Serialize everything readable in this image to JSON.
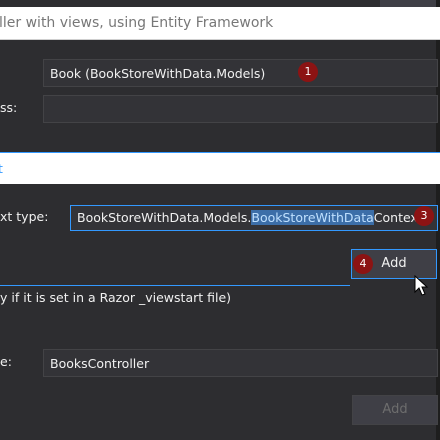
{
  "dialog": {
    "title": "ller with views, using Entity Framework"
  },
  "model": {
    "value": "Book (BookStoreWithData.Models)",
    "badge": "1"
  },
  "data_context": {
    "label_partial": "ss:"
  },
  "section": {
    "label_partial": "t"
  },
  "context_type": {
    "label_partial": "xt type:",
    "value_prefix": "BookStoreWithData.Models.",
    "value_highlighted": "BookStoreWithData",
    "value_suffix": "Context",
    "badge": "3"
  },
  "add_button": {
    "label": "Add",
    "badge": "4"
  },
  "layout_note": {
    "text": "y if it is set in a Razor _viewstart file)"
  },
  "controller_name": {
    "label_partial": "e:",
    "value": "BooksController"
  },
  "footer": {
    "add_label": "Add"
  },
  "colors": {
    "background": "#2d2d30",
    "accent": "#3399ff",
    "badge": "#8c1313"
  }
}
